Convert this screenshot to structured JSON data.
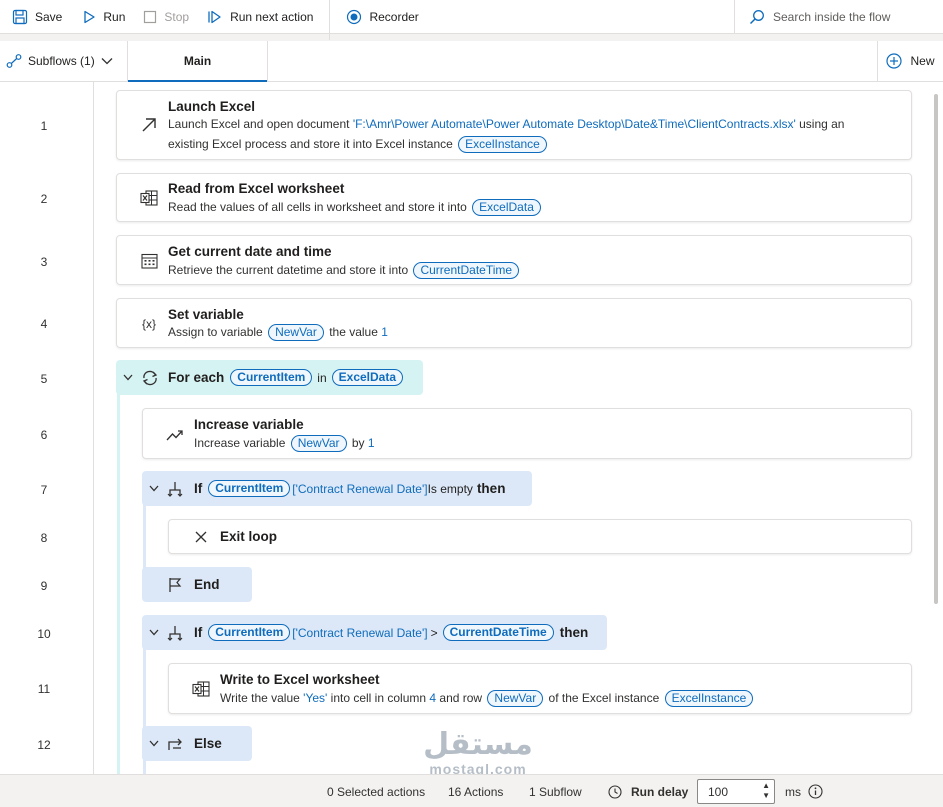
{
  "toolbar": {
    "save": "Save",
    "run": "Run",
    "stop": "Stop",
    "run_next": "Run next action",
    "recorder": "Recorder",
    "search_placeholder": "Search inside the flow"
  },
  "tabs": {
    "subflows": "Subflows (1)",
    "main": "Main",
    "new": "New"
  },
  "lines": [
    "1",
    "2",
    "3",
    "4",
    "5",
    "6",
    "7",
    "8",
    "9",
    "10",
    "11",
    "12"
  ],
  "actions": {
    "a1": {
      "title": "Launch Excel",
      "d1": "Launch Excel and open document ",
      "path": "'F:\\Amr\\Power Automate\\Power Automate Desktop\\Date&Time\\ClientContracts.xlsx'",
      "d2": " using an",
      "d3": "existing Excel process and store it into Excel instance ",
      "var": "ExcelInstance",
      "icon": "launch-arrow-icon"
    },
    "a2": {
      "title": "Read from Excel worksheet",
      "d1": "Read the values of all cells in worksheet and store it into ",
      "var": "ExcelData",
      "icon": "excel-icon"
    },
    "a3": {
      "title": "Get current date and time",
      "d1": "Retrieve the current datetime and store it into ",
      "var": "CurrentDateTime",
      "icon": "calendar-icon"
    },
    "a4": {
      "title": "Set variable",
      "d1": "Assign to variable ",
      "var": "NewVar",
      "d2": " the value ",
      "val": "1",
      "icon_text": "{x}"
    },
    "a5": {
      "title": "For each",
      "var1": "CurrentItem",
      "mid": "in",
      "var2": "ExcelData",
      "icon": "loop-icon"
    },
    "a6": {
      "title": "Increase variable",
      "d1": "Increase variable ",
      "var": "NewVar",
      "d2": " by ",
      "val": "1",
      "icon": "trend-up-icon"
    },
    "a7": {
      "kw": "If",
      "var": "CurrentItem",
      "field": "['Contract Renewal Date']",
      "cond": "Is empty",
      "then": "then",
      "icon": "if-branch-icon"
    },
    "a8": {
      "title": "Exit loop",
      "icon": "close-icon"
    },
    "a9": {
      "title": "End",
      "icon": "flag-icon"
    },
    "a10": {
      "kw": "If",
      "var1": "CurrentItem",
      "field": "['Contract Renewal Date']",
      "op": ">",
      "var2": "CurrentDateTime",
      "then": "then",
      "icon": "if-branch-icon"
    },
    "a11": {
      "title": "Write to Excel worksheet",
      "d1": "Write the value ",
      "val1": "'Yes'",
      "d2": " into cell in column ",
      "col": "4",
      "d3": " and row ",
      "var1": "NewVar",
      "d4": " of the Excel instance ",
      "var2": "ExcelInstance",
      "icon": "excel-icon"
    },
    "a12": {
      "title": "Else",
      "icon": "else-branch-icon"
    }
  },
  "status": {
    "selected": "0 Selected actions",
    "actions": "16 Actions",
    "subflow": "1 Subflow",
    "run_delay": "Run delay",
    "delay_value": "100",
    "unit": "ms"
  },
  "watermark": {
    "arabic": "مستقل",
    "latin": "mostaql.com"
  },
  "colors": {
    "accent": "#0f6cbd",
    "loop_block": "#d5f3f3",
    "if_block": "#dce8f7"
  }
}
